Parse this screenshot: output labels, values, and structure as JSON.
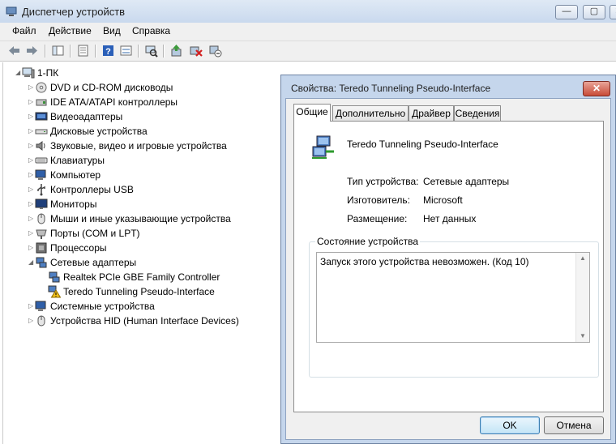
{
  "window": {
    "title": "Диспетчер устройств",
    "controls": {
      "minimize": "—",
      "maximize": "▢",
      "close": "✕"
    }
  },
  "menu": [
    "Файл",
    "Действие",
    "Вид",
    "Справка"
  ],
  "toolbar_icons": [
    "back-icon",
    "forward-icon",
    "show-hide-tree-icon",
    "properties-icon",
    "help-icon",
    "view-icon",
    "scan-hardware-icon",
    "update-driver-icon",
    "uninstall-icon",
    "disable-icon"
  ],
  "tree": {
    "root": "1-ПК",
    "categories": [
      "DVD и CD-ROM дисководы",
      "IDE ATA/ATAPI контроллеры",
      "Видеоадаптеры",
      "Дисковые устройства",
      "Звуковые, видео и игровые устройства",
      "Клавиатуры",
      "Компьютер",
      "Контроллеры USB",
      "Мониторы",
      "Мыши и иные указывающие устройства",
      "Порты (COM и LPT)",
      "Процессоры",
      "Сетевые адаптеры",
      "Realtek PCIe GBE Family Controller",
      "Teredo Tunneling Pseudo-Interface",
      "Системные устройства",
      "Устройства HID (Human Interface Devices)"
    ]
  },
  "dialog": {
    "title": "Свойства: Teredo Tunneling Pseudo-Interface",
    "close": "✕",
    "tabs": [
      "Общие",
      "Дополнительно",
      "Драйвер",
      "Сведения"
    ],
    "device_name": "Teredo Tunneling Pseudo-Interface",
    "fields": [
      {
        "label": "Тип устройства:",
        "value": "Сетевые адаптеры"
      },
      {
        "label": "Изготовитель:",
        "value": "Microsoft"
      },
      {
        "label": "Размещение:",
        "value": "Нет данных"
      }
    ],
    "status_group": "Состояние устройства",
    "status_text": "Запуск этого устройства невозможен. (Код 10)",
    "scroll_up": "▲",
    "scroll_down": "▼",
    "ok": "OK",
    "cancel": "Отмена"
  },
  "colors": {
    "accent": "#3c7fb1",
    "title_bar": "#c5d6ec",
    "warning": "#f3c21c"
  }
}
